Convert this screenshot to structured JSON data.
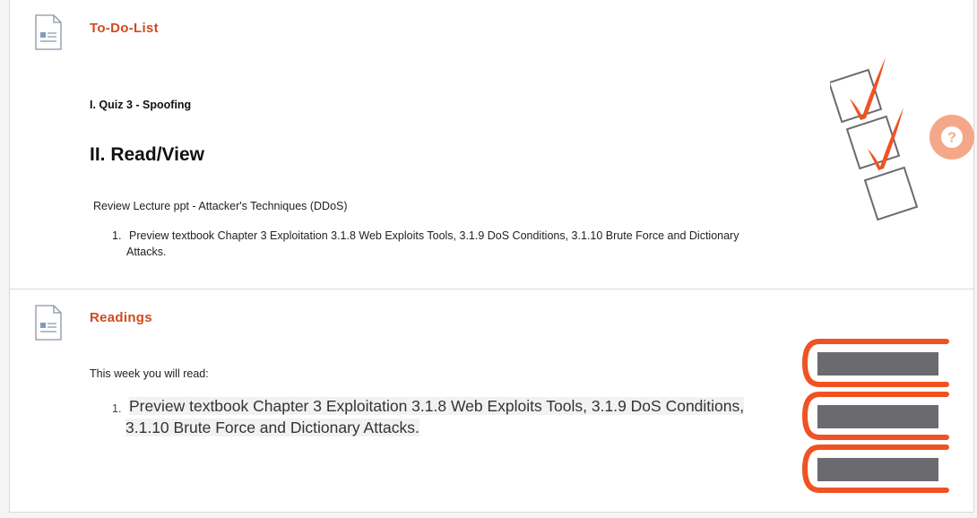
{
  "todo": {
    "title": "To-Do-List",
    "quiz": "I. Quiz 3 - Spoofing",
    "heading": "II. Read/View",
    "review": "Review Lecture ppt - Attacker's Techniques (DDoS)",
    "list": [
      {
        "num": "1.",
        "line1": "Preview textbook Chapter 3 Exploitation  3.1.8 Web Exploits Tools,  3.1.9 DoS Conditions, 3.1.10 Brute Force and Dictionary",
        "line2": "Attacks."
      }
    ]
  },
  "readings": {
    "title": "Readings",
    "intro": "This week you will read:",
    "list": [
      {
        "num": "1.",
        "line1": "Preview textbook Chapter 3 Exploitation  3.1.8 Web Exploits Tools,  3.1.9 DoS Conditions,",
        "line2": "3.1.10 Brute Force and Dictionary Attacks."
      }
    ]
  },
  "help": {
    "icon": "question-mark-icon",
    "glyph": "?"
  },
  "colors": {
    "accent": "#d04a1f",
    "art_orange": "#ef5323",
    "book_gray": "#6b6a6f",
    "help_bg": "#f5a889"
  }
}
